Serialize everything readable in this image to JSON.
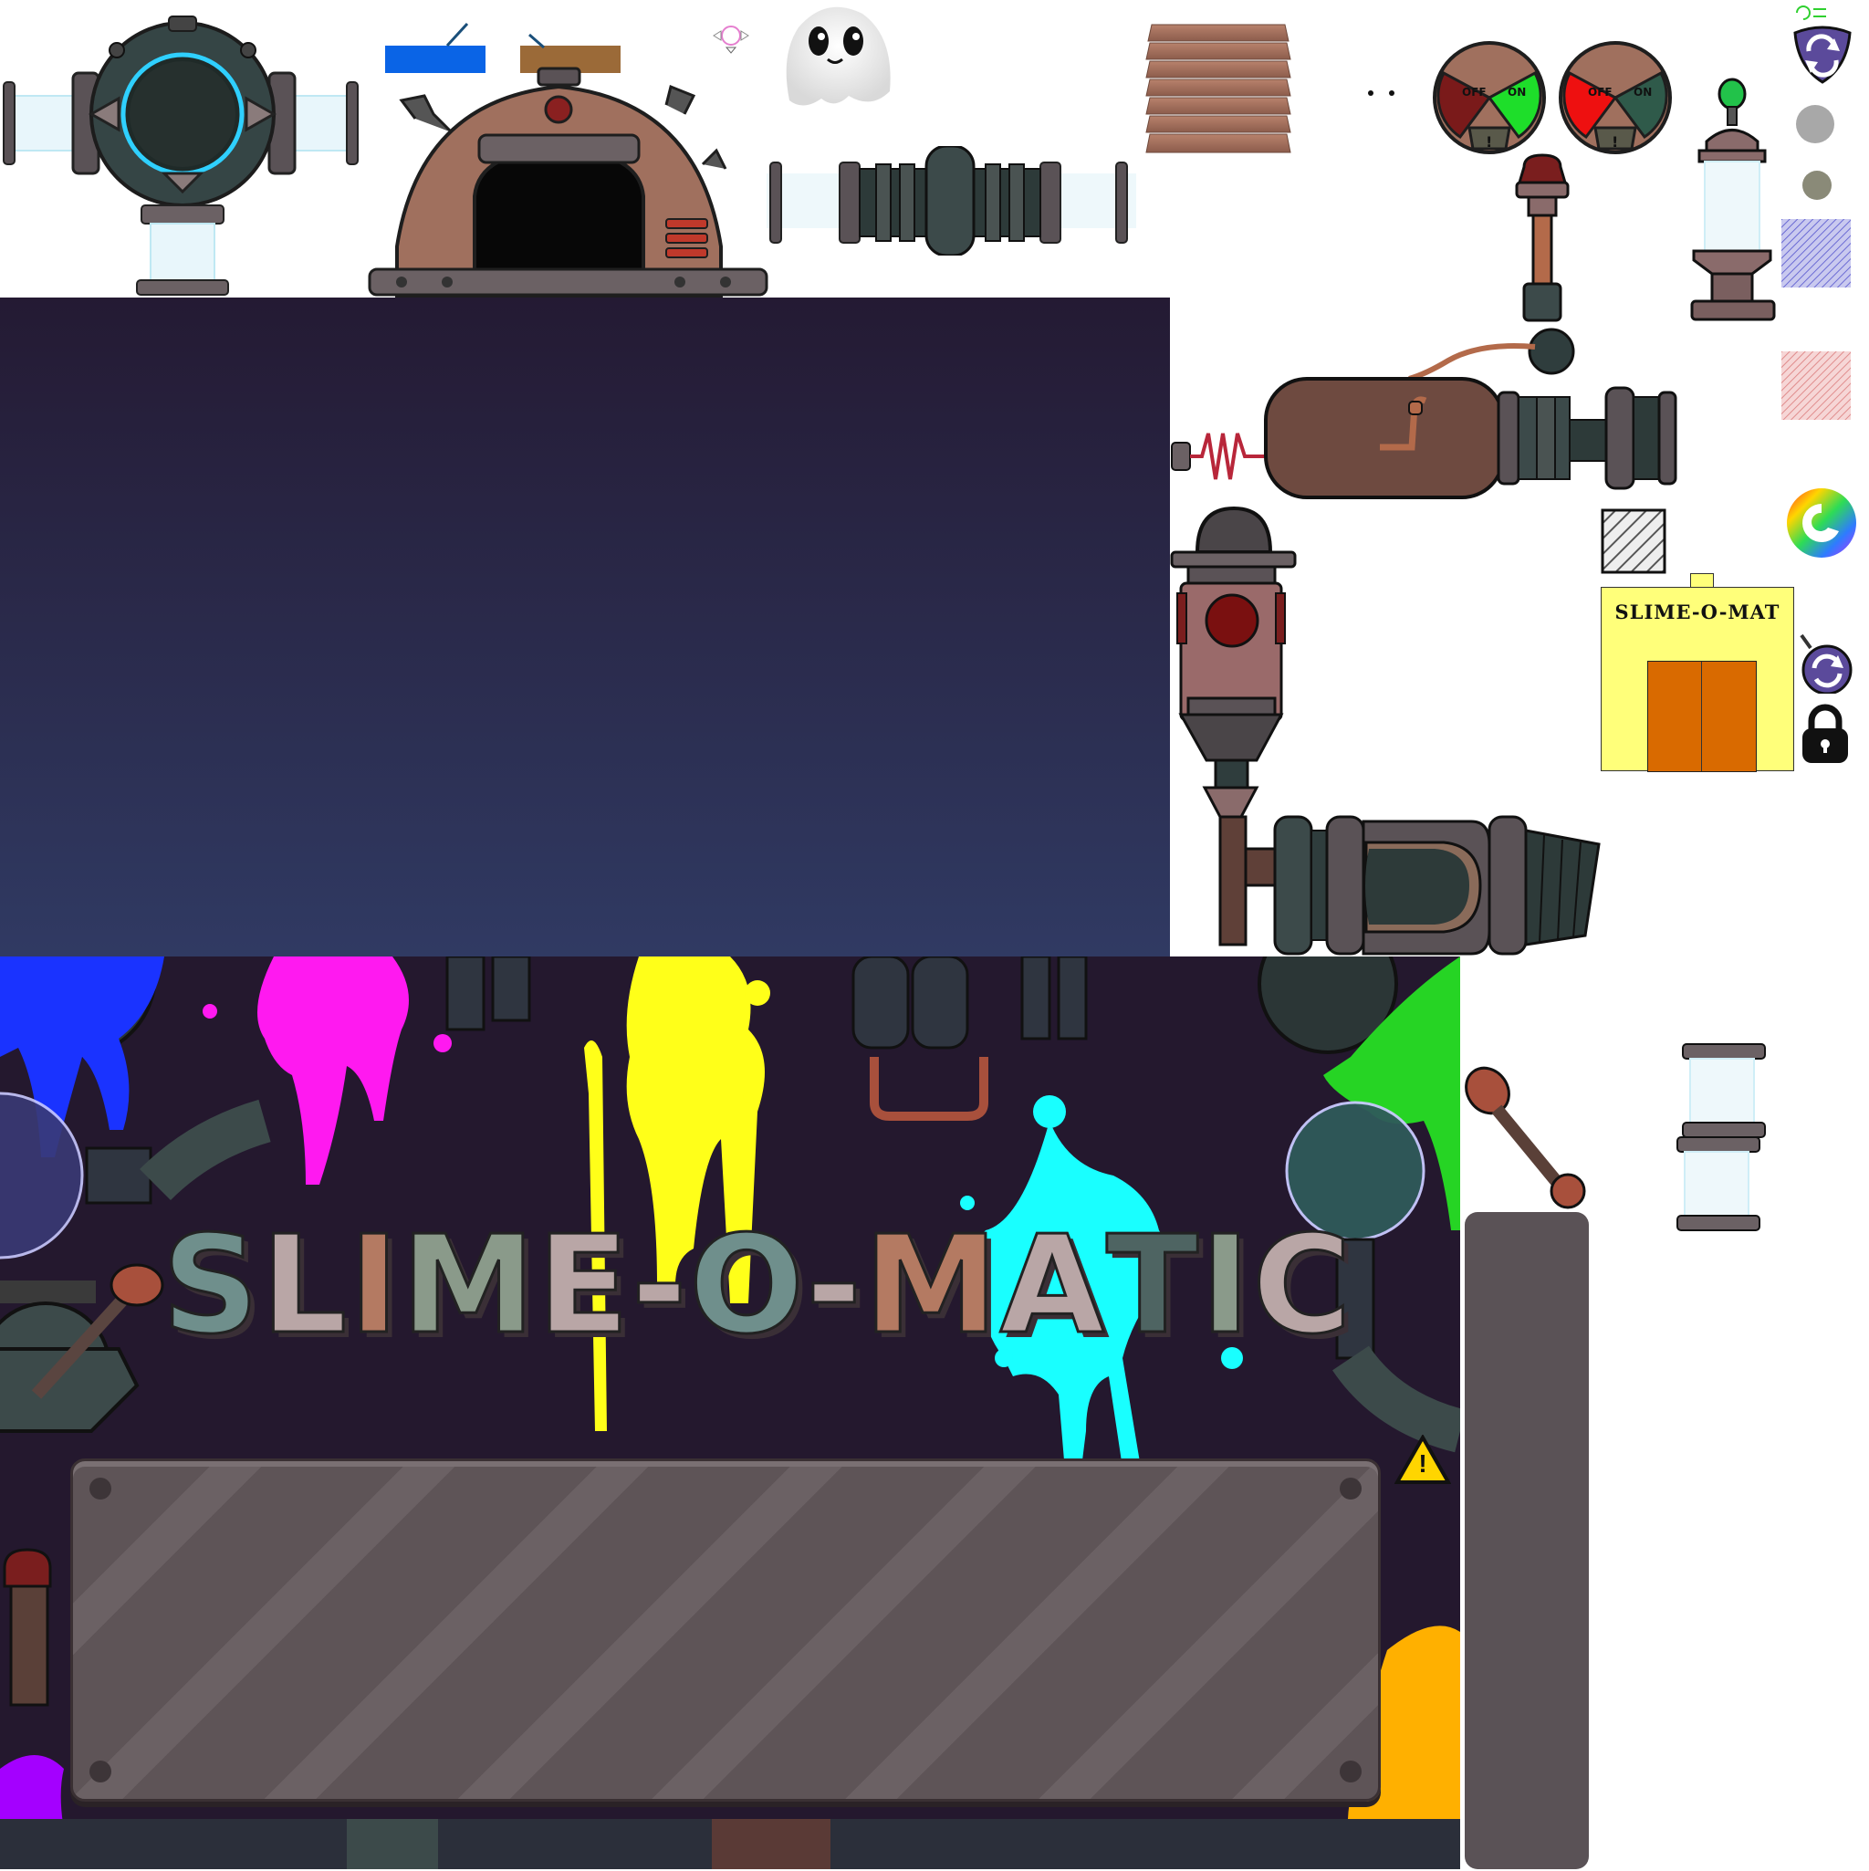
{
  "sprite_sheet": {
    "switch_labels": {
      "off": "OFF",
      "on": "ON",
      "warning": "!"
    },
    "sign_label": "SLIME-O-MAT",
    "title_letters": [
      "S",
      "L",
      "I",
      "M",
      "E",
      "-",
      "O",
      "-",
      "M",
      "A",
      "T",
      "I",
      "C"
    ],
    "warning_glyph": "!"
  },
  "colors": {
    "night_top": "#241a33",
    "night_bottom": "#303a63",
    "title_bg": "#24182e",
    "panel": "#5e5457",
    "copper": "#a0705e",
    "metal_dark": "#3c4a4a",
    "slime_blue": "#1a33ff",
    "slime_magenta": "#ff19f0",
    "slime_yellow": "#ffff19",
    "slime_cyan": "#19ffff",
    "slime_green": "#26d424",
    "slime_purple": "#a400ff",
    "slime_orange": "#ffb000",
    "sign_yellow": "#ffff7a",
    "sign_door": "#d96a00",
    "letter_teal": "#6f8f8c",
    "letter_copper": "#b47a62",
    "letter_pink": "#b9a6a6"
  },
  "icons": {
    "porthole": "porthole-icon",
    "furnace": "slime-furnace-icon",
    "ghost": "ghost-slime-icon",
    "switch": "off-on-switch-icon",
    "refresh": "refresh-badge-icon",
    "lock": "padlock-icon",
    "color_wheel": "color-swirl-icon",
    "warning": "warning-sign-icon"
  }
}
